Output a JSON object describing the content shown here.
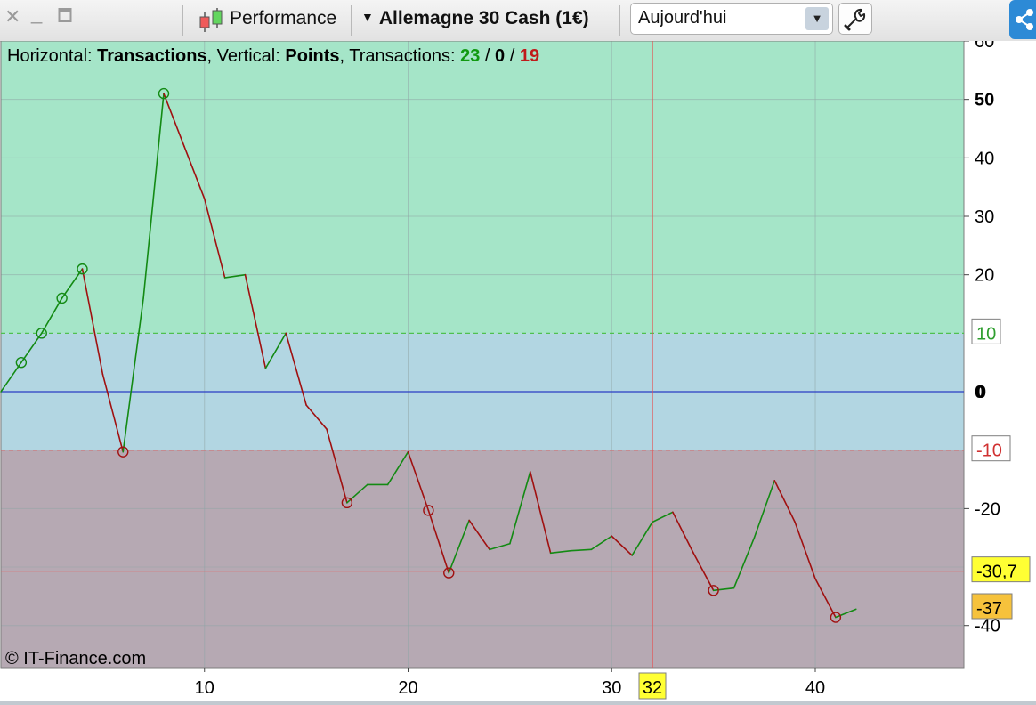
{
  "toolbar": {
    "window_controls": [
      "close-icon",
      "minimize-icon",
      "maximize-icon"
    ],
    "performance_label": "Performance",
    "instrument_label": "Allemagne 30 Cash (1€)",
    "period_select_value": "Aujourd'hui",
    "settings_icon": "wrench-icon",
    "share_icon": "share-icon"
  },
  "chart_data": {
    "type": "line",
    "header": {
      "h_label": "Horizontal: ",
      "h_value": "Transactions",
      "v_label": ", Vertical: ",
      "v_value": "Points",
      "t_label": ", Transactions: ",
      "wins": "23",
      "slash1": " / ",
      "neutral": "0",
      "slash2": " / ",
      "losses": "19"
    },
    "copyright": "© IT-Finance.com",
    "xlim": [
      0,
      47.3
    ],
    "ylim": [
      -47.2,
      60
    ],
    "x_ticks": [
      10,
      20,
      30,
      40
    ],
    "y_ticks": [
      60,
      50,
      40,
      30,
      20,
      -20,
      -40
    ],
    "y_bold_ticks": [
      50,
      0
    ],
    "y_ticks_labels": [
      "60",
      "50",
      "40",
      "30",
      "20",
      "0",
      "-20",
      "-40"
    ],
    "zones": [
      {
        "from": 10,
        "to": 60,
        "color": "#a5e5c8"
      },
      {
        "from": -10,
        "to": 10,
        "color": "#b2d6e2"
      },
      {
        "from": -47.2,
        "to": -10,
        "color": "#b6a9b3"
      }
    ],
    "reference_lines": [
      {
        "y": 10,
        "label": "10",
        "style": "dashed",
        "color": "#4fc04f",
        "label_color": "#2e9e2e",
        "label_bg": "#ffffff"
      },
      {
        "y": 0,
        "label": "0",
        "style": "solid",
        "color": "#2a3ec4",
        "label_color": "#000000",
        "label_bg": "none"
      },
      {
        "y": -10,
        "label": "-10",
        "style": "dashed",
        "color": "#e05a5a",
        "label_color": "#d03030",
        "label_bg": "#ffffff"
      },
      {
        "y": -30.7,
        "label": "-30,7",
        "style": "solid",
        "color": "#e86464",
        "label_color": "#000000",
        "label_bg": "#ffff33"
      }
    ],
    "current_value": {
      "y": -37,
      "label": "-37",
      "label_bg": "#f6c23c"
    },
    "cursor": {
      "x": 32,
      "label": "32",
      "color": "#e65050"
    },
    "series": [
      {
        "x": [
          0,
          1,
          2,
          3,
          4,
          5,
          6,
          7,
          8,
          9,
          10,
          11,
          12,
          13,
          14,
          15,
          16,
          17,
          18,
          19,
          20,
          21,
          22,
          23,
          24,
          25,
          26,
          27,
          28,
          29,
          30,
          31,
          32,
          33,
          34,
          35,
          36,
          37,
          38,
          39,
          40,
          41,
          42
        ],
        "y": [
          0,
          5,
          10,
          16,
          21,
          3,
          -10.3,
          16,
          51,
          42,
          33,
          19.5,
          20,
          4,
          10,
          -2.3,
          -6.4,
          -19,
          -15.9,
          -15.9,
          -10.3,
          -20.3,
          -31,
          -22,
          -27,
          -26,
          -13.7,
          -27.6,
          -27.2,
          -27,
          -24.7,
          -28,
          -22.3,
          -20.6,
          -27.5,
          -34,
          -33.6,
          -25,
          -15.2,
          -22.3,
          -32,
          -38.6,
          -37.2
        ],
        "up_color": "#138a13",
        "down_color": "#a01010",
        "markers": [
          {
            "index": 1,
            "kind": "win"
          },
          {
            "index": 2,
            "kind": "win"
          },
          {
            "index": 3,
            "kind": "win"
          },
          {
            "index": 4,
            "kind": "win"
          },
          {
            "index": 6,
            "kind": "loss"
          },
          {
            "index": 8,
            "kind": "win"
          },
          {
            "index": 17,
            "kind": "loss"
          },
          {
            "index": 21,
            "kind": "loss"
          },
          {
            "index": 22,
            "kind": "loss"
          },
          {
            "index": 35,
            "kind": "loss"
          },
          {
            "index": 41,
            "kind": "loss"
          }
        ]
      }
    ],
    "grid": true
  }
}
